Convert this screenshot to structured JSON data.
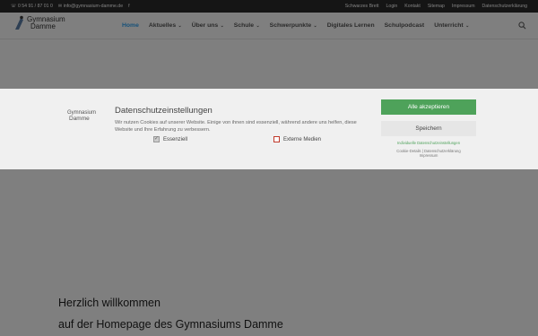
{
  "topbar": {
    "phone": "0 54 91 / 87 01 0",
    "email": "info@gymnasium-damme.de",
    "social_icon": "facebook-icon",
    "links": [
      "Schwarzes Brett",
      "Login",
      "Kontakt",
      "Sitemap",
      "Impressum",
      "Datenschutzerklärung"
    ]
  },
  "logo": {
    "line1": "Gymnasium",
    "line2": "Damme"
  },
  "nav": {
    "items": [
      {
        "label": "Home",
        "active": true,
        "dropdown": false
      },
      {
        "label": "Aktuelles",
        "dropdown": true
      },
      {
        "label": "Über uns",
        "dropdown": true
      },
      {
        "label": "Schule",
        "dropdown": true
      },
      {
        "label": "Schwerpunkte",
        "dropdown": true
      },
      {
        "label": "Digitales Lernen",
        "dropdown": false
      },
      {
        "label": "Schulpodcast",
        "dropdown": false
      },
      {
        "label": "Unterricht",
        "dropdown": true
      }
    ]
  },
  "main": {
    "welcome_line1": "Herzlich willkommen",
    "welcome_line2": "auf der Homepage des Gymnasiums Damme"
  },
  "cookie": {
    "logo_line1": "Gymnasium",
    "logo_line2": "Damme",
    "title": "Datenschutzeinstellungen",
    "description": "Wir nutzen Cookies auf unserer Website. Einige von ihnen sind essenziell, während andere uns helfen, diese Website und Ihre Erfahrung zu verbessern.",
    "checkbox_essential": "Essenziell",
    "checkbox_external": "Externe Medien",
    "accept_all": "Alle akzeptieren",
    "save": "Speichern",
    "individual": "Individuelle Datenschutzeinstellungen",
    "cookie_details": "Cookie-Details",
    "separator": "|",
    "privacy": "Datenschutzerklärung",
    "imprint": "Impressum"
  },
  "colors": {
    "accent": "#2ea3f2",
    "accept": "#4ea25a",
    "topbar": "#2a2a2a"
  }
}
